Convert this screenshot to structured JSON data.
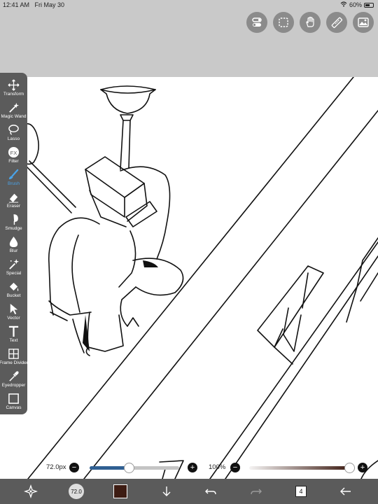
{
  "status_bar": {
    "time": "12:41 AM",
    "date": "Fri May 30",
    "battery": "60%",
    "battery_level": 0.6
  },
  "top_tools": [
    {
      "name": "settings-toggle-icon"
    },
    {
      "name": "selection-icon"
    },
    {
      "name": "hand-icon"
    },
    {
      "name": "ruler-icon"
    },
    {
      "name": "material-icon"
    }
  ],
  "tools": [
    {
      "id": "transform",
      "label": "Transform",
      "icon": "move-arrows-icon"
    },
    {
      "id": "magic-wand",
      "label": "Magic Wand",
      "icon": "magic-wand-icon"
    },
    {
      "id": "lasso",
      "label": "Lasso",
      "icon": "lasso-icon"
    },
    {
      "id": "filter",
      "label": "Filter",
      "icon": "fx-icon",
      "text": "FX"
    },
    {
      "id": "brush",
      "label": "Brush",
      "icon": "brush-icon",
      "active": true
    },
    {
      "id": "eraser",
      "label": "Eraser",
      "icon": "eraser-icon"
    },
    {
      "id": "smudge",
      "label": "Smudge",
      "icon": "smudge-icon"
    },
    {
      "id": "blur",
      "label": "Blur",
      "icon": "droplet-icon"
    },
    {
      "id": "special",
      "label": "Special",
      "icon": "sparkle-wand-icon"
    },
    {
      "id": "bucket",
      "label": "Bucket",
      "icon": "bucket-icon"
    },
    {
      "id": "vector",
      "label": "Vector",
      "icon": "cursor-arrow-icon"
    },
    {
      "id": "text",
      "label": "Text",
      "icon": "text-t-icon",
      "text": "T"
    },
    {
      "id": "frame-divider",
      "label": "Frame Divider",
      "icon": "frame-divider-icon"
    },
    {
      "id": "eyedropper",
      "label": "Eyedropper",
      "icon": "eyedropper-icon"
    },
    {
      "id": "canvas",
      "label": "Canvas",
      "icon": "canvas-icon"
    }
  ],
  "brush_size": {
    "value": "72.0px",
    "fraction": 0.44,
    "minus": "−",
    "plus": "+"
  },
  "opacity": {
    "value": "100%",
    "fraction": 1.0,
    "minus": "−",
    "plus": "+"
  },
  "bottom_bar": {
    "brush_preview_label": "72.0",
    "color": "#3d1c13",
    "layer_count": "4"
  },
  "colors": {
    "accent": "#4aa3e8",
    "toolbar": "#5b5b5b",
    "slider_fill": "#2f5f92"
  }
}
